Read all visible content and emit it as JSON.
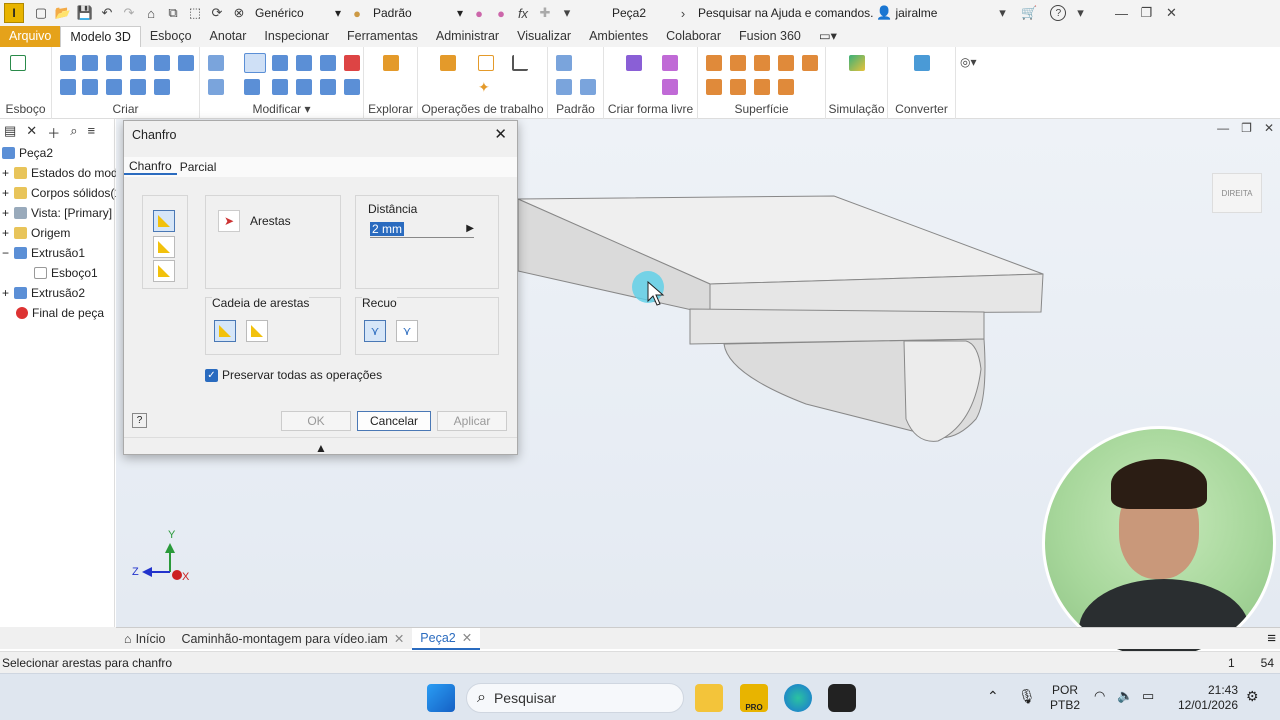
{
  "titlebar": {
    "material": "Genérico",
    "appearance": "Padrão",
    "document_title": "Peça2",
    "search_placeholder": "Pesquisar na Ajuda e comandos.",
    "user": "jairalme",
    "logo_letter": "I",
    "fx": "fx",
    "help": "?"
  },
  "menu": [
    "Arquivo",
    "Modelo 3D",
    "Esboço",
    "Anotar",
    "Inspecionar",
    "Ferramentas",
    "Administrar",
    "Visualizar",
    "Ambientes",
    "Colaborar",
    "Fusion 360"
  ],
  "ribbon_groups": [
    "Esboço",
    "Criar",
    "Modificar ▾",
    "Explorar",
    "Operações de trabalho",
    "Padrão",
    "Criar forma livre",
    "Superfície",
    "Simulação",
    "Converter"
  ],
  "browser": {
    "items": [
      "Peça2",
      "Estados do mode",
      "Corpos sólidos(1",
      "Vista: [Primary]",
      "Origem",
      "Extrusão1",
      "Esboço1",
      "Extrusão2",
      "Final de peça"
    ]
  },
  "dialog": {
    "title": "Chanfro",
    "tabs": [
      "Chanfro",
      "Parcial"
    ],
    "edges_label": "Arestas",
    "distance_label": "Distância",
    "distance_value": "2 mm",
    "edge_chain_label": "Cadeia de arestas",
    "setback_label": "Recuo",
    "preserve_label": "Preservar todas as operações",
    "preserve_checked": true,
    "ok": "OK",
    "cancel": "Cancelar",
    "apply": "Aplicar",
    "help": "?"
  },
  "viewcube_label": "DIREITA",
  "axes": {
    "y": "Y",
    "z": "Z",
    "x": "X"
  },
  "doc_tabs": [
    "Início",
    "Caminhão-montagem para vídeo.iam",
    "Peça2"
  ],
  "status": {
    "message": "Selecionar arestas para chanfro",
    "num1": "1",
    "num2": "54"
  },
  "taskbar": {
    "search": "Pesquisar",
    "lang1": "POR",
    "lang2": "PTB2",
    "time": "21:43",
    "date": "12/01/2026",
    "pro_label": "PRO"
  },
  "colors": {
    "accent": "#e5a21a",
    "selection": "#2a6bbf"
  }
}
